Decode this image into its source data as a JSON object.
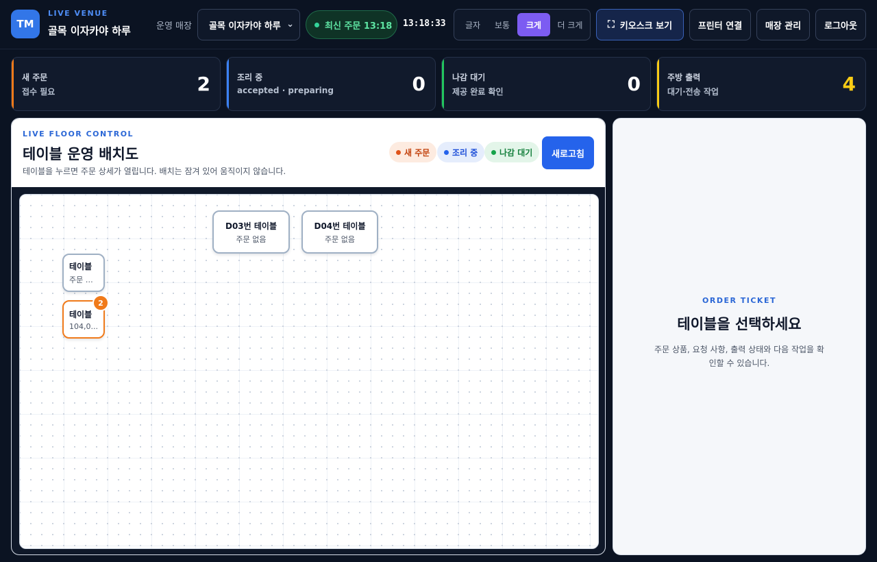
{
  "header": {
    "logo_initials": "TM",
    "venue_kicker": "LIVE VENUE",
    "venue_name": "골목 이자카야 하루",
    "store_label": "운영 매장",
    "store_select_value": "골목 이자카야 하루",
    "latest_order": "최신 주문 13:18",
    "clock": "13:18:33",
    "text_sizes": [
      {
        "label": "글자",
        "active": false
      },
      {
        "label": "보통",
        "active": false
      },
      {
        "label": "크게",
        "active": true
      },
      {
        "label": "더 크게",
        "active": false
      }
    ],
    "kiosk_button": "키오스크 보기",
    "printer_button": "프린터 연결",
    "store_manage_button": "매장 관리",
    "logout_button": "로그아웃"
  },
  "stats": [
    {
      "title": "새 주문",
      "sub": "접수 필요",
      "value": "2",
      "accent": "#f07a1a",
      "value_color": "#ffffff"
    },
    {
      "title": "조리 중",
      "sub": "accepted · preparing",
      "value": "0",
      "accent": "#3b82f6",
      "value_color": "#ffffff"
    },
    {
      "title": "나감 대기",
      "sub": "제공 완료 확인",
      "value": "0",
      "accent": "#22c55e",
      "value_color": "#ffffff"
    },
    {
      "title": "주방 출력",
      "sub": "대기·전송 작업",
      "value": "4",
      "accent": "#facc15",
      "value_color": "#facc15"
    }
  ],
  "floor": {
    "kicker": "LIVE FLOOR CONTROL",
    "title": "테이블 운영 배치도",
    "description": "테이블을 누르면 주문 상세가 열립니다. 배치는 잠겨 있어 움직이지 않습니다.",
    "legend": [
      {
        "label": "새 주문",
        "dot": "#e0531a",
        "color": "#c2410c",
        "bg": "#fdebe0"
      },
      {
        "label": "조리 중",
        "dot": "#2563eb",
        "color": "#1d4ed8",
        "bg": "#e5edfc"
      },
      {
        "label": "나감 대기",
        "dot": "#16a34a",
        "color": "#15803d",
        "bg": "#e3f5e9"
      }
    ],
    "refresh_button": "새로고침",
    "tables": [
      {
        "name": "D03번 테이블",
        "sub": "주문 없음",
        "badge": ""
      },
      {
        "name": "D04번 테이블",
        "sub": "주문 없음",
        "badge": ""
      },
      {
        "name": "테이블",
        "sub": "주문 없음",
        "badge": ""
      },
      {
        "name": "테이블",
        "sub": "104,0...",
        "badge": "2"
      }
    ]
  },
  "ticket": {
    "kicker": "ORDER TICKET",
    "title": "테이블을 선택하세요",
    "description": "주문 상품, 요청 사항, 출력 상태와 다음 작업을 확인할 수 있습니다."
  }
}
